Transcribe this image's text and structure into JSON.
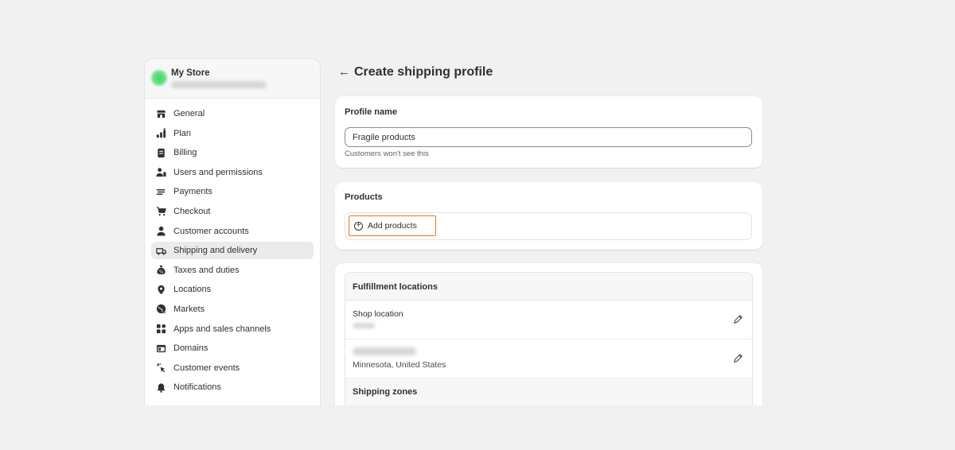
{
  "store": {
    "name": "My Store"
  },
  "sidebar": {
    "items": [
      {
        "label": "General",
        "icon": "store-icon"
      },
      {
        "label": "Plan",
        "icon": "plan-chart-icon"
      },
      {
        "label": "Billing",
        "icon": "receipt-icon"
      },
      {
        "label": "Users and permissions",
        "icon": "users-icon"
      },
      {
        "label": "Payments",
        "icon": "payments-icon"
      },
      {
        "label": "Checkout",
        "icon": "cart-icon"
      },
      {
        "label": "Customer accounts",
        "icon": "person-icon"
      },
      {
        "label": "Shipping and delivery",
        "icon": "truck-icon",
        "active": true
      },
      {
        "label": "Taxes and duties",
        "icon": "money-bag-icon"
      },
      {
        "label": "Locations",
        "icon": "location-pin-icon"
      },
      {
        "label": "Markets",
        "icon": "globe-icon"
      },
      {
        "label": "Apps and sales channels",
        "icon": "apps-icon"
      },
      {
        "label": "Domains",
        "icon": "domain-icon"
      },
      {
        "label": "Customer events",
        "icon": "cursor-click-icon"
      },
      {
        "label": "Notifications",
        "icon": "bell-icon"
      }
    ]
  },
  "header": {
    "title": "Create shipping profile",
    "back_icon": "arrow-left-icon"
  },
  "profile": {
    "title": "Profile name",
    "input_value": "Fragile products",
    "help_text": "Customers won't see this"
  },
  "products": {
    "title": "Products",
    "add_label": "Add products"
  },
  "locations": {
    "title": "Fulfillment locations",
    "rows": [
      {
        "name": "Shop location"
      },
      {
        "sub": "Minnesota, United States"
      }
    ],
    "zones_title": "Shipping zones"
  },
  "colors": {
    "highlight": "#e8771e",
    "avatar": "#3fd46a"
  }
}
